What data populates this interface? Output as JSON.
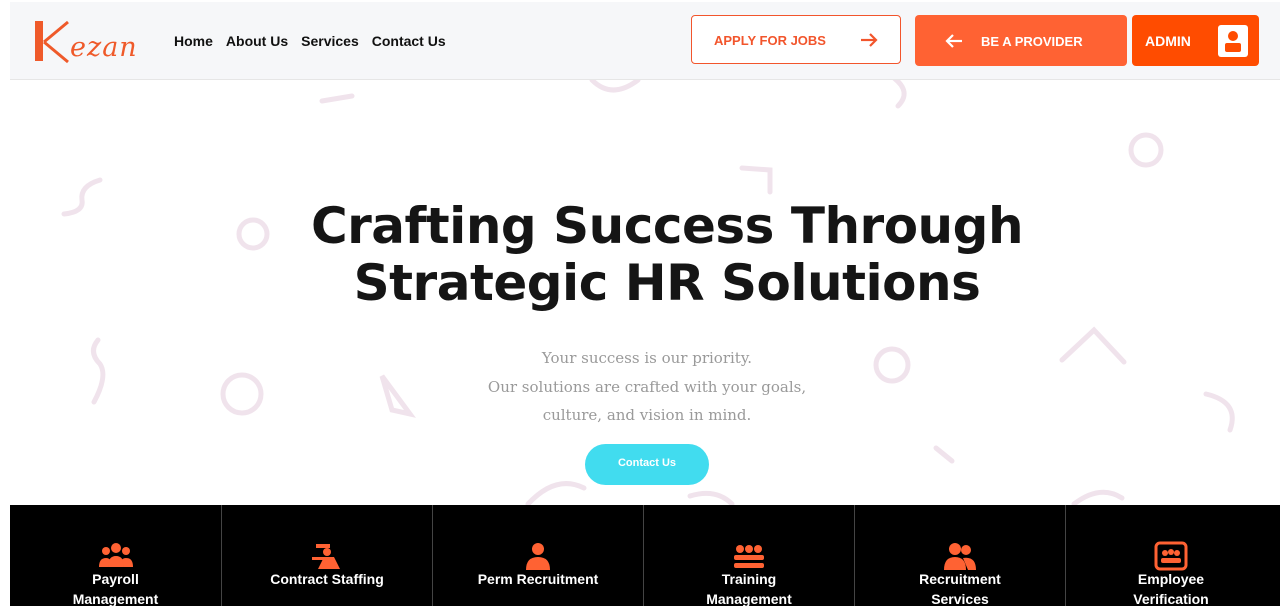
{
  "brand": {
    "name": "ezan",
    "accent": "#f2552c"
  },
  "nav": {
    "home": "Home",
    "about": "About Us",
    "services": "Services",
    "contact": "Contact Us"
  },
  "header_buttons": {
    "apply": "APPLY FOR JOBS",
    "provider": "BE A PROVIDER",
    "admin": "ADMIN"
  },
  "hero": {
    "title_line1": "Crafting Success Through",
    "title_line2": "Strategic HR Solutions",
    "subtitle_line1": "Your success is our priority.",
    "subtitle_line2": "Our solutions are crafted with your goals,",
    "subtitle_line3": "culture, and vision in mind.",
    "cta": "Contact Us"
  },
  "services": [
    {
      "line1": "Payroll",
      "line2": "Management",
      "icon": "group-icon"
    },
    {
      "line1": "Contract Staffing",
      "line2": "",
      "icon": "worker-icon"
    },
    {
      "line1": "Perm Recruitment",
      "line2": "",
      "icon": "employee-icon"
    },
    {
      "line1": "Training",
      "line2": "Management",
      "icon": "training-icon"
    },
    {
      "line1": "Recruitment",
      "line2": "Services",
      "icon": "people-icon"
    },
    {
      "line1": "Employee",
      "line2": "Verification",
      "icon": "verification-icon"
    }
  ],
  "colors": {
    "primary": "#ff6233",
    "admin": "#ff4c00",
    "cta": "#41dcef",
    "band": "#000000"
  }
}
